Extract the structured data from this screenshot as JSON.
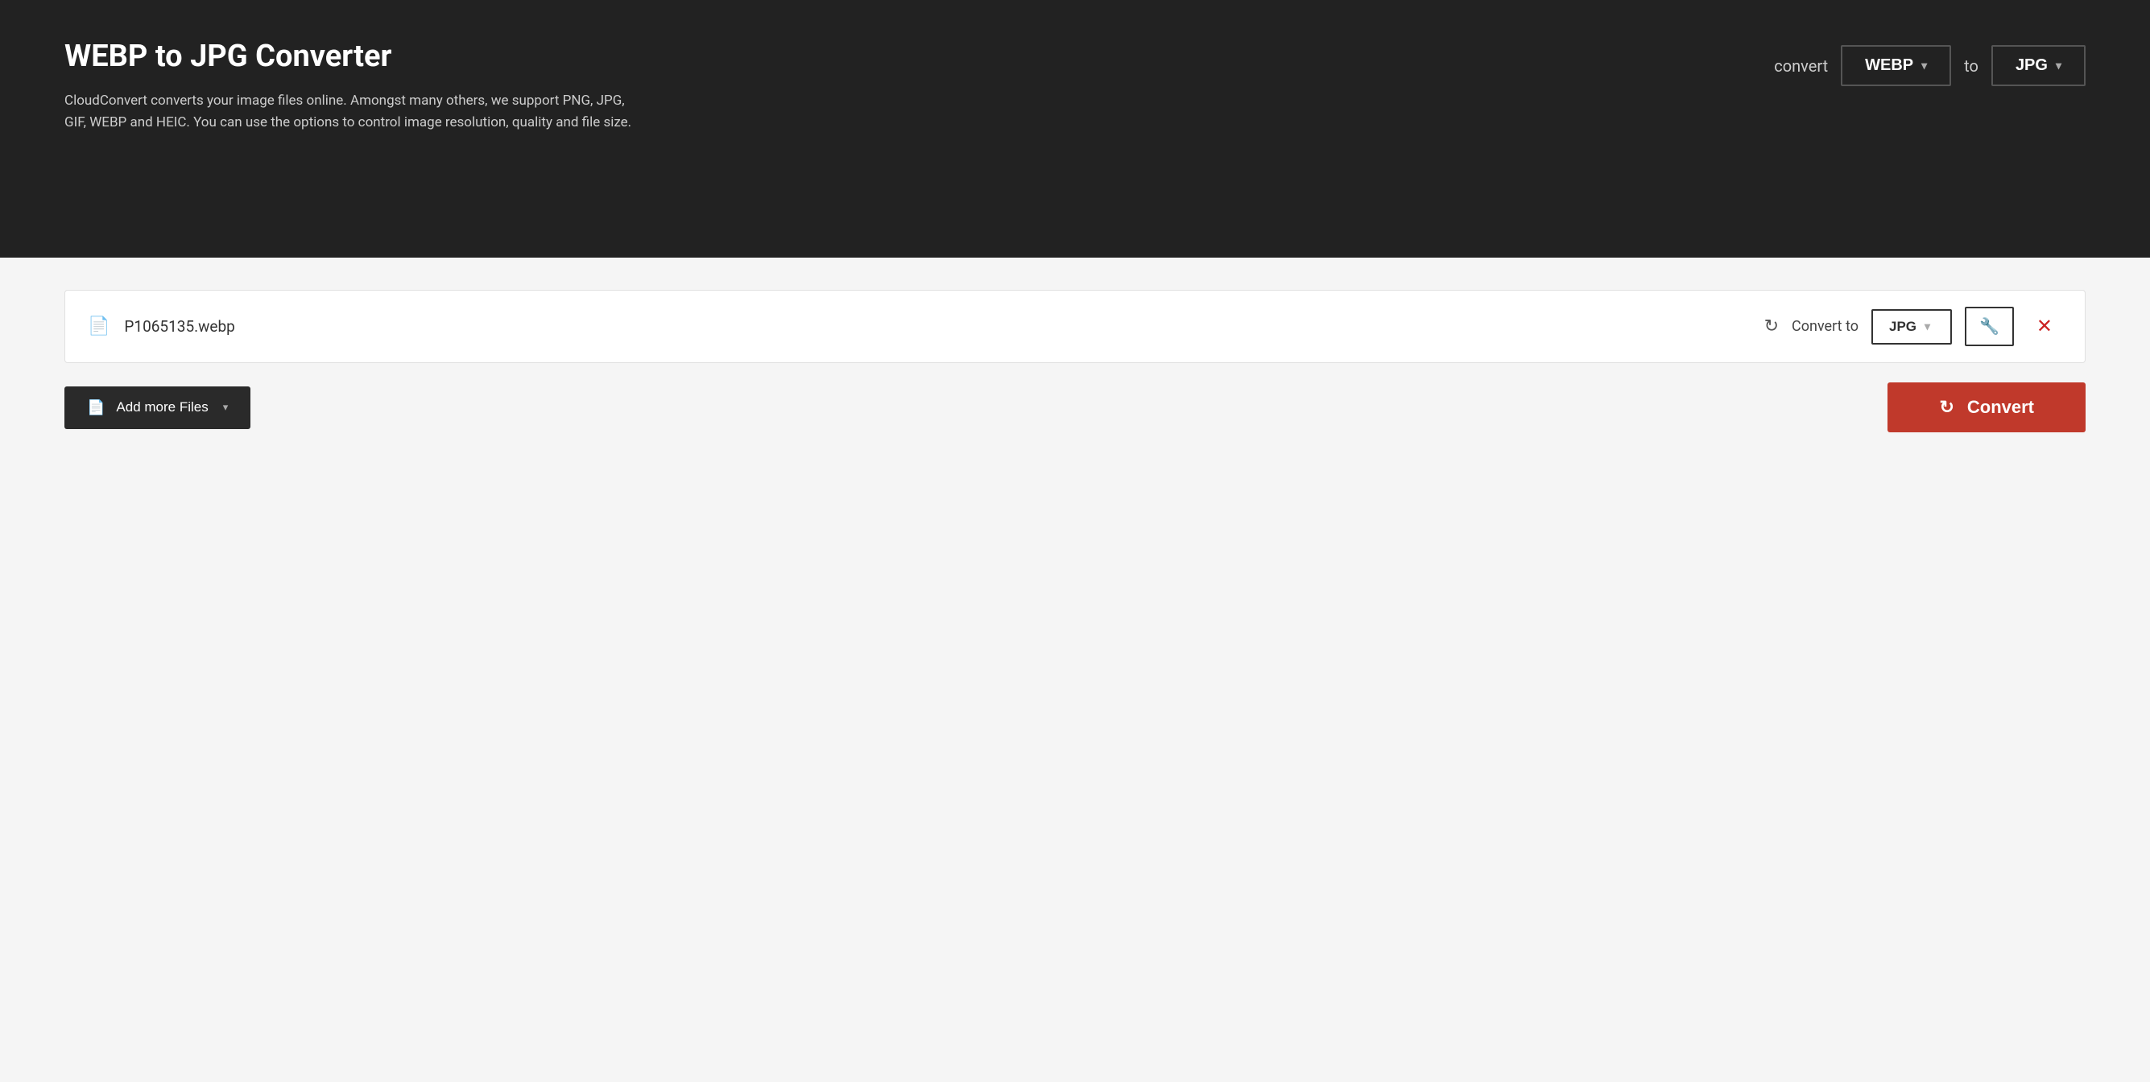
{
  "header": {
    "title": "WEBP to JPG Converter",
    "description": "CloudConvert converts your image files online. Amongst many others, we support PNG, JPG, GIF, WEBP and HEIC. You can use the options to control image resolution, quality and file size.",
    "convert_label": "convert",
    "from_format": "WEBP",
    "to_label": "to",
    "to_format": "JPG"
  },
  "file_row": {
    "filename": "P1065135.webp",
    "convert_to_label": "Convert to",
    "format": "JPG"
  },
  "toolbar": {
    "add_files_label": "Add more Files",
    "convert_label": "Convert"
  },
  "colors": {
    "header_bg": "#222222",
    "convert_btn_bg": "#c0392b",
    "add_files_btn_bg": "#2a2a2a"
  }
}
